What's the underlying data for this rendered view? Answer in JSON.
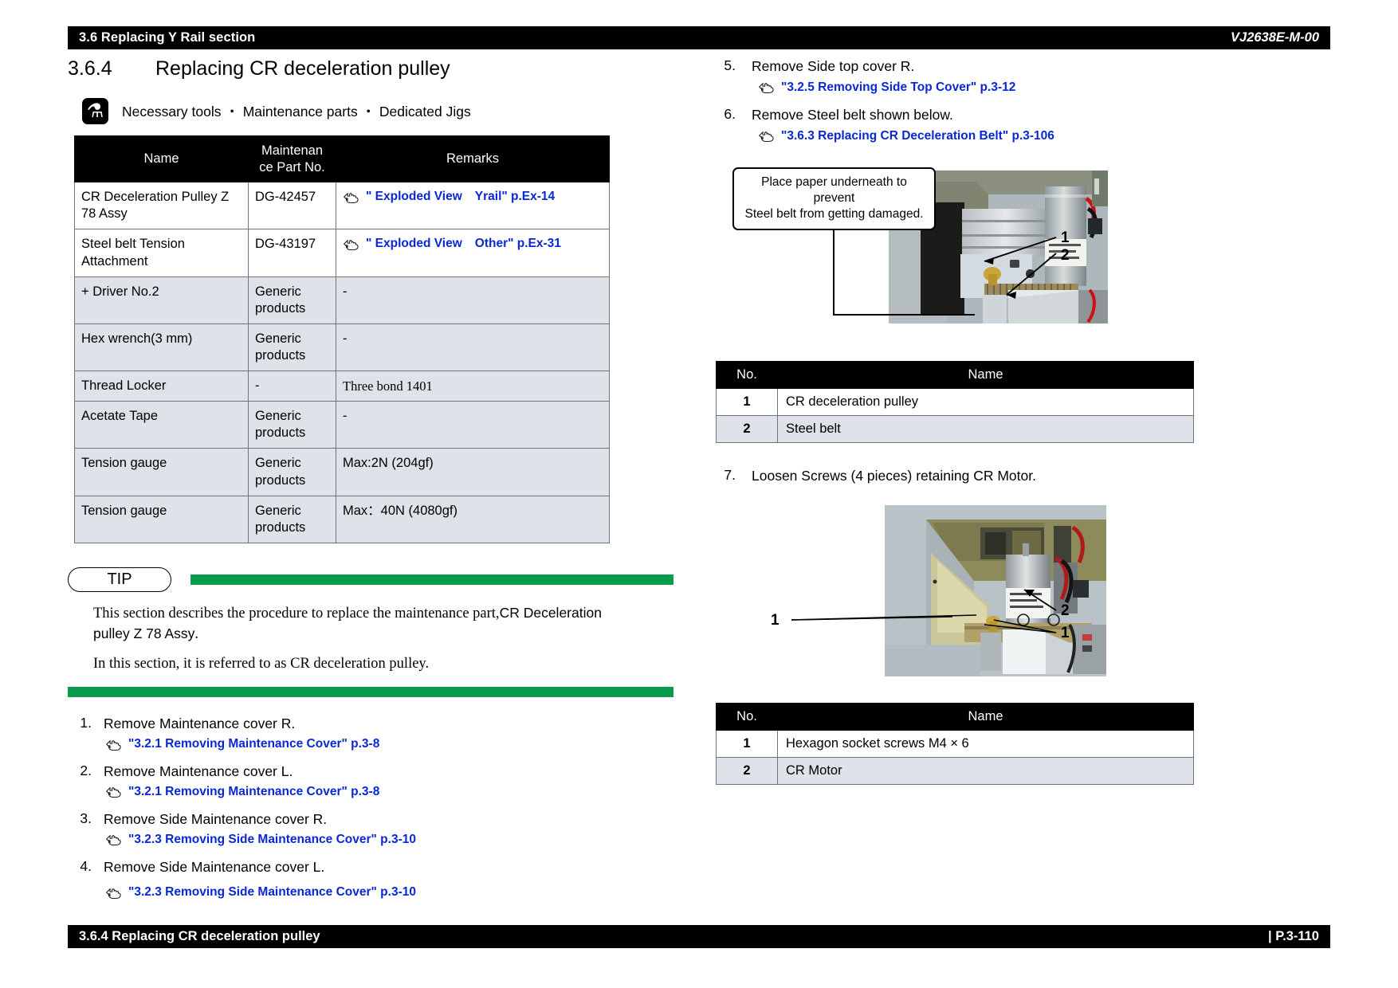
{
  "header": {
    "section_title": "3.6 Replacing Y Rail section",
    "doc_code": "VJ2638E-M-00"
  },
  "footer": {
    "section_title": "3.6.4 Replacing CR deceleration pulley",
    "page_number": "| P.3-110"
  },
  "section": {
    "number": "3.6.4",
    "title": "Replacing CR deceleration pulley",
    "tools_heading": "Necessary tools ・ Maintenance parts ・ Dedicated Jigs",
    "tools_icon": "wrench-screwdriver-icon"
  },
  "parts_table": {
    "headers": [
      "Name",
      "Maintenance Part No.",
      "Remarks"
    ],
    "header_col2_line1": "Maintenan",
    "header_col2_line2": "ce Part No.",
    "rows": [
      {
        "name": "CR Deceleration Pulley Z 78 Assy",
        "part_no": "DG-42457",
        "remark_type": "link",
        "remark_a": "\" Exploded View",
        "remark_b": "Yrail\" p.Ex-14",
        "shaded": false
      },
      {
        "name": "Steel belt Tension Attachment",
        "part_no": "DG-43197",
        "remark_type": "link",
        "remark_a": "\" Exploded View",
        "remark_b": "Other\" p.Ex-31",
        "shaded": false
      },
      {
        "name": "+ Driver No.2",
        "part_no": "Generic products",
        "remark_type": "text",
        "remark_a": "-",
        "remark_b": "",
        "shaded": true
      },
      {
        "name": "Hex wrench(3 mm)",
        "part_no": "Generic products",
        "remark_type": "text",
        "remark_a": "-",
        "remark_b": "",
        "shaded": true
      },
      {
        "name": "Thread Locker",
        "part_no": "-",
        "remark_type": "serif",
        "remark_a": "Three bond 1401",
        "remark_b": "",
        "shaded": true
      },
      {
        "name": "Acetate Tape",
        "part_no": "Generic products",
        "remark_type": "text",
        "remark_a": "-",
        "remark_b": "",
        "shaded": true
      },
      {
        "name": "Tension gauge",
        "part_no": "Generic products",
        "remark_type": "text",
        "remark_a": "Max:2N (204gf)",
        "remark_b": "",
        "shaded": true
      },
      {
        "name": "Tension gauge",
        "part_no": "Generic products",
        "remark_type": "text",
        "remark_a": "Max：40N (4080gf)",
        "remark_b": "",
        "shaded": true
      }
    ]
  },
  "tip": {
    "label": "TIP",
    "paragraph1_a": "This section describes the procedure to replace the maintenance part,",
    "paragraph1_b": "CR Deceleration pulley Z 78 Assy",
    "paragraph1_c": ".",
    "paragraph2": "In this section, it is referred to as CR deceleration pulley.",
    "bar_color": "#0a9c4e"
  },
  "steps_left": [
    {
      "num": "1.",
      "text": "Remove Maintenance cover R.",
      "link": "\"3.2.1 Removing Maintenance Cover\" p.3-8"
    },
    {
      "num": "2.",
      "text": "Remove Maintenance cover L.",
      "link": "\"3.2.1 Removing Maintenance Cover\" p.3-8"
    },
    {
      "num": "3.",
      "text": "Remove Side Maintenance cover R.",
      "link": "\"3.2.3 Removing Side Maintenance Cover\" p.3-10"
    },
    {
      "num": "4.",
      "text": "Remove Side Maintenance cover L.",
      "link": "\"3.2.3 Removing Side Maintenance Cover\" p.3-10"
    }
  ],
  "steps_right": [
    {
      "num": "5.",
      "text": "Remove Side top cover R.",
      "link": "\"3.2.5 Removing Side Top Cover\" p.3-12"
    },
    {
      "num": "6.",
      "text": "Remove Steel belt shown below.",
      "link": "\"3.6.3 Replacing CR Deceleration Belt\" p.3-106"
    }
  ],
  "figure1": {
    "callout_line1": "Place paper underneath to prevent",
    "callout_line2": "Steel belt from getting damaged.",
    "markers": [
      "1",
      "2"
    ],
    "photo_alt": "carriage-motor-steel-belt-photo"
  },
  "table1": {
    "headers": [
      "No.",
      "Name"
    ],
    "rows": [
      {
        "no": "1",
        "name": "CR deceleration pulley",
        "shaded": false
      },
      {
        "no": "2",
        "name": "Steel belt",
        "shaded": true
      }
    ]
  },
  "step7": {
    "num": "7.",
    "text": "Loosen Screws (4 pieces) retaining CR Motor."
  },
  "figure2": {
    "markers": [
      "1",
      "2",
      "1"
    ],
    "photo_alt": "cr-motor-screws-photo"
  },
  "table2": {
    "headers": [
      "No.",
      "Name"
    ],
    "rows": [
      {
        "no": "1",
        "name": "Hexagon socket screws M4 × 6",
        "shaded": false
      },
      {
        "no": "2",
        "name": "CR Motor",
        "shaded": true
      }
    ]
  }
}
